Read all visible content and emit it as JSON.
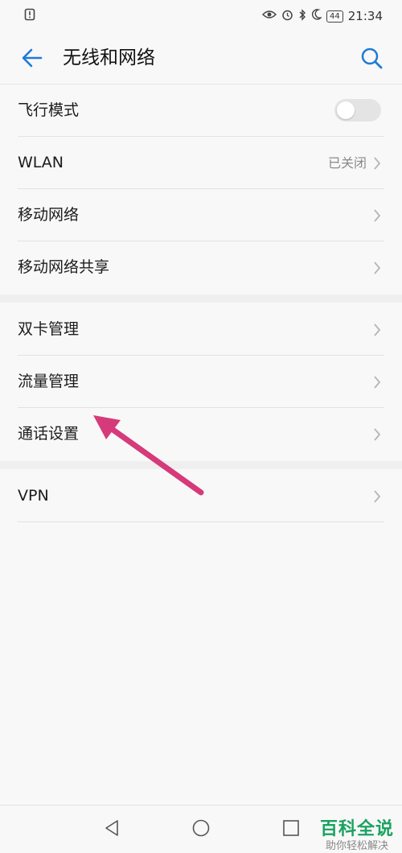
{
  "status_bar": {
    "time": "21:34",
    "battery": "44"
  },
  "header": {
    "title": "无线和网络"
  },
  "sections": [
    {
      "items": [
        {
          "label": "飞行模式",
          "type": "toggle",
          "on": false
        },
        {
          "label": "WLAN",
          "type": "link",
          "value": "已关闭"
        },
        {
          "label": "移动网络",
          "type": "link"
        },
        {
          "label": "移动网络共享",
          "type": "link"
        }
      ]
    },
    {
      "items": [
        {
          "label": "双卡管理",
          "type": "link"
        },
        {
          "label": "流量管理",
          "type": "link"
        },
        {
          "label": "通话设置",
          "type": "link"
        }
      ]
    },
    {
      "items": [
        {
          "label": "VPN",
          "type": "link"
        }
      ]
    }
  ],
  "watermark": {
    "title": "百科全说",
    "subtitle": "助你轻松解决"
  },
  "colors": {
    "accent": "#1f7ad6",
    "annotation_arrow": "#d63a7b",
    "watermark": "#1aa260"
  }
}
